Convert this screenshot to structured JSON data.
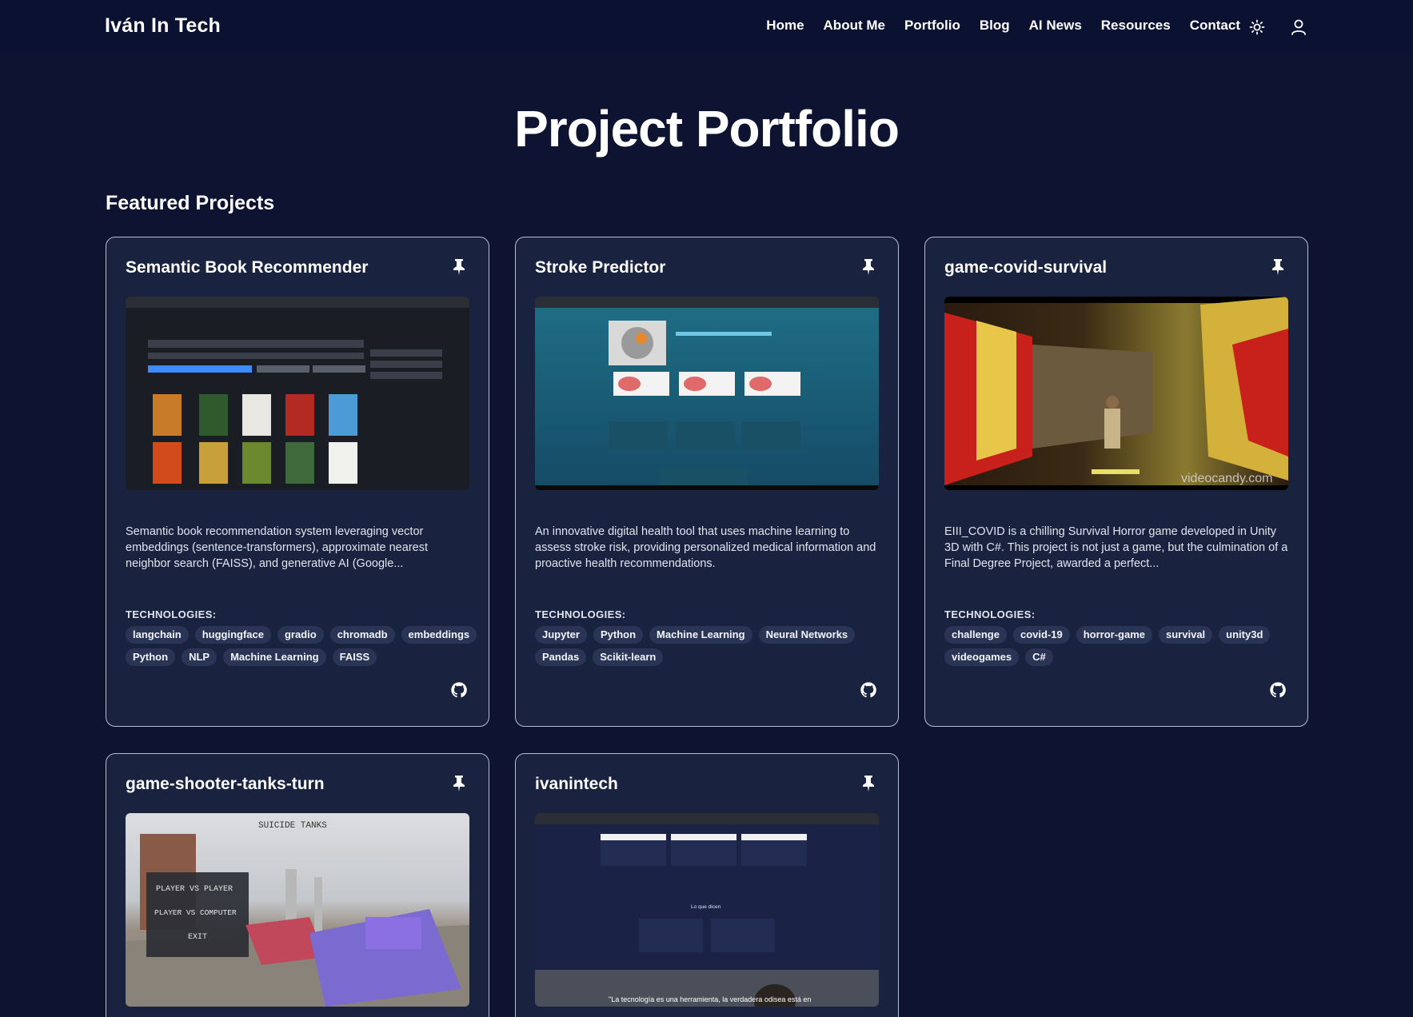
{
  "header": {
    "brand": "Iván In Tech",
    "nav": [
      "Home",
      "About Me",
      "Portfolio",
      "Blog",
      "AI News",
      "Resources",
      "Contact"
    ],
    "theme_icon": "sun-icon",
    "user_icon": "user-icon"
  },
  "page": {
    "title": "Project Portfolio",
    "section_title": "Featured Projects"
  },
  "projects": [
    {
      "title": "Semantic Book Recommender",
      "description": "Semantic book recommendation system leveraging vector embeddings (sentence-transformers), approximate nearest neighbor search (FAISS), and generative AI (Google...",
      "tech_label": "TECHNOLOGIES:",
      "tags": [
        "langchain",
        "huggingface",
        "gradio",
        "chromadb",
        "embeddings",
        "Python",
        "NLP",
        "Machine Learning",
        "FAISS"
      ]
    },
    {
      "title": "Stroke Predictor",
      "description": "An innovative digital health tool that uses machine learning to assess stroke risk, providing personalized medical information and proactive health recommendations.",
      "tech_label": "TECHNOLOGIES:",
      "tags": [
        "Jupyter",
        "Python",
        "Machine Learning",
        "Neural Networks",
        "Pandas",
        "Scikit-learn"
      ]
    },
    {
      "title": "game-covid-survival",
      "description": "EIII_COVID is a chilling Survival Horror game developed in Unity 3D with C#. This project is not just a game, but the culmination of a Final Degree Project, awarded a perfect...",
      "tech_label": "TECHNOLOGIES:",
      "tags": [
        "challenge",
        "covid-19",
        "horror-game",
        "survival",
        "unity3d",
        "videogames",
        "C#"
      ],
      "thumb_watermark": "videocandy.com"
    },
    {
      "title": "game-shooter-tanks-turn",
      "thumb_text": {
        "title": "SUICIDE TANKS",
        "menu": [
          "PLAYER VS PLAYER",
          "PLAYER VS COMPUTER",
          "EXIT"
        ]
      }
    },
    {
      "title": "ivanintech",
      "thumb_text": {
        "caption": "Lo que dicen",
        "quote": "\"La tecnología es una herramienta, la verdadera odisea está en"
      }
    }
  ],
  "icons": {
    "pin": "pin-icon",
    "github": "github-icon"
  },
  "colors": {
    "background": "#0d1330",
    "card": "#19223f",
    "tag": "#2a3556",
    "border": "#b9bfd0"
  }
}
